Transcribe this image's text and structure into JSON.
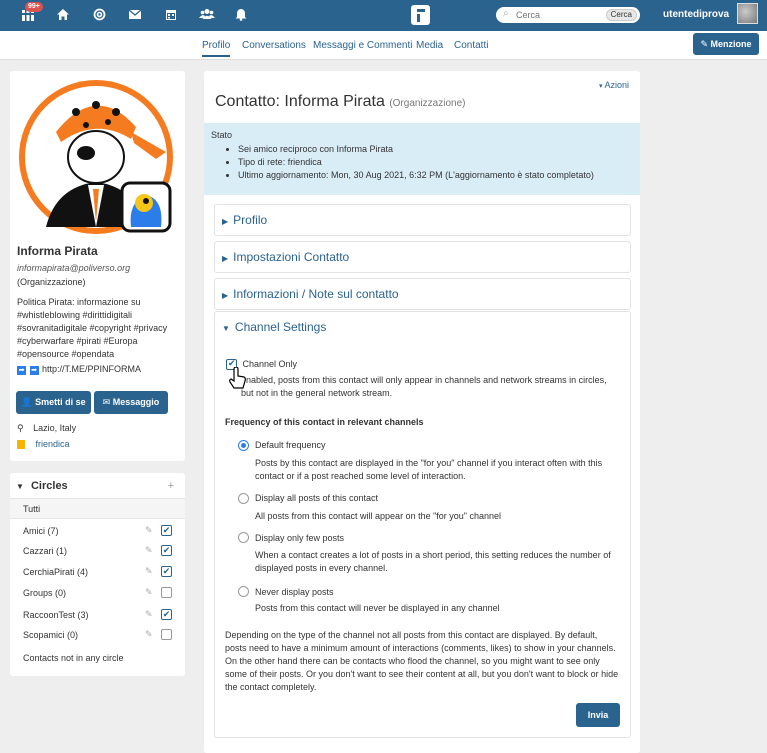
{
  "topbar": {
    "notifications_badge": "99+",
    "search_placeholder": "Cerca",
    "search_button": "Cerca",
    "username": "utentediprova"
  },
  "subnav": {
    "tabs": [
      "Profilo",
      "Conversations",
      "Messaggi e Commenti",
      "Media",
      "Contatti"
    ],
    "mention_button": "Menzione"
  },
  "profile": {
    "name": "Informa Pirata",
    "address": "informapirata@poliverso.org",
    "type": "(Organizzazione)",
    "description": "Politica Pirata: informazione su #whistleblowing #dirittidigitali #sovranitadigitale #copyright #privacy #cyberwarfare #pirati #Europa #opensource #opendata",
    "link": "http://T.ME/PPINFORMA",
    "follow_button": "Smetti di se",
    "message_button": "Messaggio",
    "location": "Lazio, Italy",
    "network": "friendica"
  },
  "circles": {
    "title": "Circles",
    "items": [
      {
        "label": "Tutti",
        "checkbox": false,
        "checked": false
      },
      {
        "label": "Amici (7)",
        "checkbox": true,
        "checked": true
      },
      {
        "label": "Cazzari (1)",
        "checkbox": true,
        "checked": true
      },
      {
        "label": "CerchiaPirati (4)",
        "checkbox": true,
        "checked": true
      },
      {
        "label": "Groups (0)",
        "checkbox": true,
        "checked": false
      },
      {
        "label": "RaccoonTest (3)",
        "checkbox": true,
        "checked": true
      },
      {
        "label": "Scopamici (0)",
        "checkbox": true,
        "checked": false
      },
      {
        "label": "Contacts not in any circle",
        "checkbox": false,
        "checked": false
      }
    ]
  },
  "main": {
    "actions": "Azioni",
    "title": "Contatto: Informa Pirata",
    "title_type": "(Organizzazione)",
    "status": {
      "heading": "Stato",
      "lines": [
        "Sei amico reciproco con Informa Pirata",
        "Tipo di rete: friendica",
        "Ultimo aggiornamento: Mon, 30 Aug 2021, 6:32 PM (L'aggiornamento è stato completato)"
      ]
    },
    "sections": [
      "Profilo",
      "Impostazioni Contatto",
      "Informazioni / Note sul contatto",
      "Channel Settings"
    ],
    "channel_only": {
      "label": "Channel Only",
      "description": "enabled, posts from this contact will only appear in channels and network streams in circles, but not in the general network stream."
    },
    "frequency_title": "Frequency of this contact in relevant channels",
    "frequency_options": [
      {
        "label": "Default frequency",
        "description": "Posts by this contact are displayed in the \"for you\" channel if you interact often with this contact or if a post reached some level of interaction.",
        "selected": true
      },
      {
        "label": "Display all posts of this contact",
        "description": "All posts from this contact will appear on the \"for you\" channel",
        "selected": false
      },
      {
        "label": "Display only few posts",
        "description": "When a contact creates a lot of posts in a short period, this setting reduces the number of displayed posts in every channel.",
        "selected": false
      },
      {
        "label": "Never display posts",
        "description": "Posts from this contact will never be displayed in any channel",
        "selected": false
      }
    ],
    "footnote": "Depending on the type of the channel not all posts from this contact are displayed. By default, posts need to have a minimum amount of interactions (comments, likes) to show in your channels. On the other hand there can be contacts who flood the channel, so you might want to see only some of their posts. Or you don't want to see their content at all, but you don't want to block or hide the contact completely.",
    "submit_button": "Invia"
  },
  "colors": {
    "brand": "#2b638f",
    "status_bg": "#d9edf7",
    "badge": "#d9534f"
  }
}
